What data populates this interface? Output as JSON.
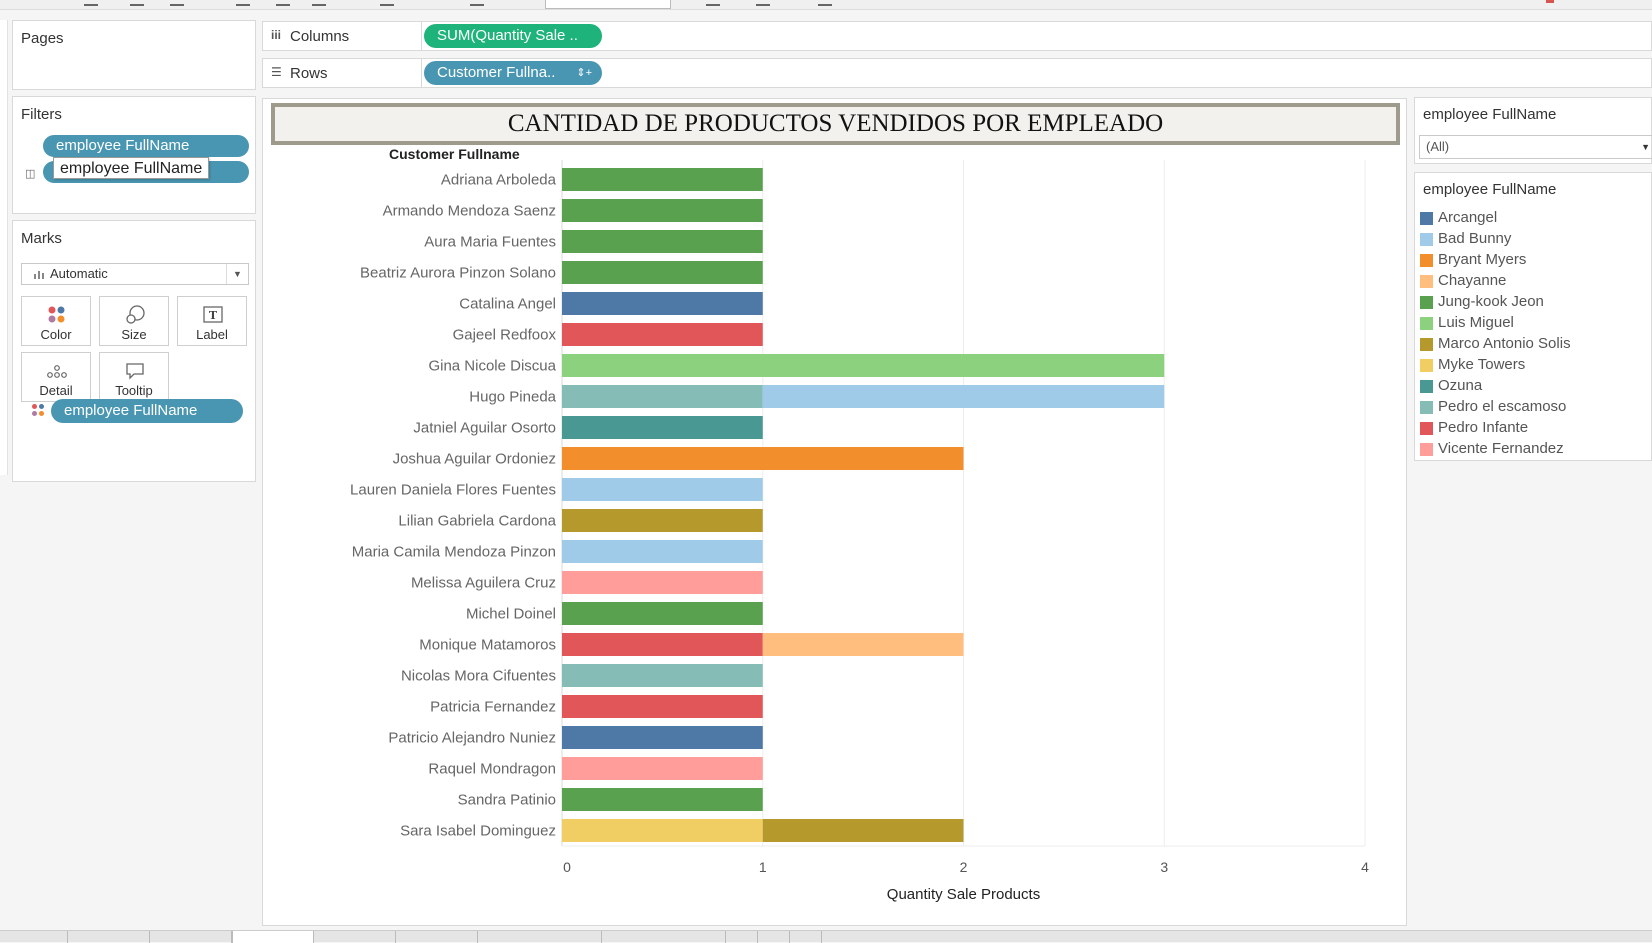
{
  "left_panel": {
    "pages_title": "Pages",
    "filters_title": "Filters",
    "filter_pill": "employee FullName",
    "filter_tooltip": "employee FullName",
    "marks_title": "Marks",
    "marks_type": "Automatic",
    "mark_buttons": [
      "Color",
      "Size",
      "Label",
      "Detail",
      "Tooltip"
    ],
    "marks_pill": "employee FullName"
  },
  "shelves": {
    "columns_label": "Columns",
    "columns_pill": "SUM(Quantity Sale ..",
    "rows_label": "Rows",
    "rows_pill": "Customer Fullna..",
    "rows_sort_icon": "sort-icon"
  },
  "right_panel": {
    "filter_title": "employee FullName",
    "filter_value": "(All)",
    "legend_title": "employee FullName",
    "legend": [
      {
        "name": "Arcangel",
        "color": "#4e79a7"
      },
      {
        "name": "Bad Bunny",
        "color": "#a0cbe8"
      },
      {
        "name": "Bryant Myers",
        "color": "#f28e2b"
      },
      {
        "name": "Chayanne",
        "color": "#ffbe7d"
      },
      {
        "name": "Jung-kook Jeon",
        "color": "#59a14f"
      },
      {
        "name": "Luis Miguel",
        "color": "#8cd17d"
      },
      {
        "name": "Marco Antonio Solis",
        "color": "#b6992d"
      },
      {
        "name": "Myke Towers",
        "color": "#f1ce63"
      },
      {
        "name": "Ozuna",
        "color": "#499894"
      },
      {
        "name": "Pedro el escamoso",
        "color": "#86bcb6"
      },
      {
        "name": "Pedro Infante",
        "color": "#e15759"
      },
      {
        "name": "Vicente Fernandez",
        "color": "#ff9d9a"
      }
    ]
  },
  "chart_data": {
    "type": "bar",
    "orientation": "horizontal",
    "stacked": true,
    "title": "CANTIDAD DE PRODUCTOS VENDIDOS POR EMPLEADO",
    "row_header": "Customer Fullname",
    "xlabel": "Quantity Sale Products",
    "xlim": [
      0,
      4
    ],
    "xticks": [
      "0",
      "1",
      "2",
      "3",
      "4"
    ],
    "grid": true,
    "rows": [
      {
        "customer": "Adriana Arboleda",
        "segments": [
          {
            "employee": "Jung-kook Jeon",
            "value": 1
          }
        ]
      },
      {
        "customer": "Armando Mendoza Saenz",
        "segments": [
          {
            "employee": "Jung-kook Jeon",
            "value": 1
          }
        ]
      },
      {
        "customer": "Aura Maria Fuentes",
        "segments": [
          {
            "employee": "Jung-kook Jeon",
            "value": 1
          }
        ]
      },
      {
        "customer": "Beatriz Aurora Pinzon Solano",
        "segments": [
          {
            "employee": "Jung-kook Jeon",
            "value": 1
          }
        ]
      },
      {
        "customer": "Catalina Angel",
        "segments": [
          {
            "employee": "Arcangel",
            "value": 1
          }
        ]
      },
      {
        "customer": "Gajeel Redfoox",
        "segments": [
          {
            "employee": "Pedro Infante",
            "value": 1
          }
        ]
      },
      {
        "customer": "Gina Nicole Discua",
        "segments": [
          {
            "employee": "Luis Miguel",
            "value": 3
          }
        ]
      },
      {
        "customer": "Hugo Pineda",
        "segments": [
          {
            "employee": "Pedro el escamoso",
            "value": 1
          },
          {
            "employee": "Bad Bunny",
            "value": 2
          }
        ]
      },
      {
        "customer": "Jatniel Aguilar Osorto",
        "segments": [
          {
            "employee": "Ozuna",
            "value": 1
          }
        ]
      },
      {
        "customer": "Joshua Aguilar Ordoniez",
        "segments": [
          {
            "employee": "Bryant Myers",
            "value": 2
          }
        ]
      },
      {
        "customer": "Lauren Daniela Flores Fuentes",
        "segments": [
          {
            "employee": "Bad Bunny",
            "value": 1
          }
        ]
      },
      {
        "customer": "Lilian Gabriela Cardona",
        "segments": [
          {
            "employee": "Marco Antonio Solis",
            "value": 1
          }
        ]
      },
      {
        "customer": "Maria Camila Mendoza Pinzon",
        "segments": [
          {
            "employee": "Bad Bunny",
            "value": 1
          }
        ]
      },
      {
        "customer": "Melissa Aguilera Cruz",
        "segments": [
          {
            "employee": "Vicente Fernandez",
            "value": 1
          }
        ]
      },
      {
        "customer": "Michel Doinel",
        "segments": [
          {
            "employee": "Jung-kook Jeon",
            "value": 1
          }
        ]
      },
      {
        "customer": "Monique Matamoros",
        "segments": [
          {
            "employee": "Pedro Infante",
            "value": 1
          },
          {
            "employee": "Chayanne",
            "value": 1
          }
        ]
      },
      {
        "customer": "Nicolas Mora Cifuentes",
        "segments": [
          {
            "employee": "Pedro el escamoso",
            "value": 1
          }
        ]
      },
      {
        "customer": "Patricia Fernandez",
        "segments": [
          {
            "employee": "Pedro Infante",
            "value": 1
          }
        ]
      },
      {
        "customer": "Patricio Alejandro Nuniez",
        "segments": [
          {
            "employee": "Arcangel",
            "value": 1
          }
        ]
      },
      {
        "customer": "Raquel Mondragon",
        "segments": [
          {
            "employee": "Vicente Fernandez",
            "value": 1
          }
        ]
      },
      {
        "customer": "Sandra Patinio",
        "segments": [
          {
            "employee": "Jung-kook Jeon",
            "value": 1
          }
        ]
      },
      {
        "customer": "Sara Isabel Dominguez",
        "segments": [
          {
            "employee": "Myke Towers",
            "value": 1
          },
          {
            "employee": "Marco Antonio Solis",
            "value": 1
          }
        ]
      }
    ]
  }
}
